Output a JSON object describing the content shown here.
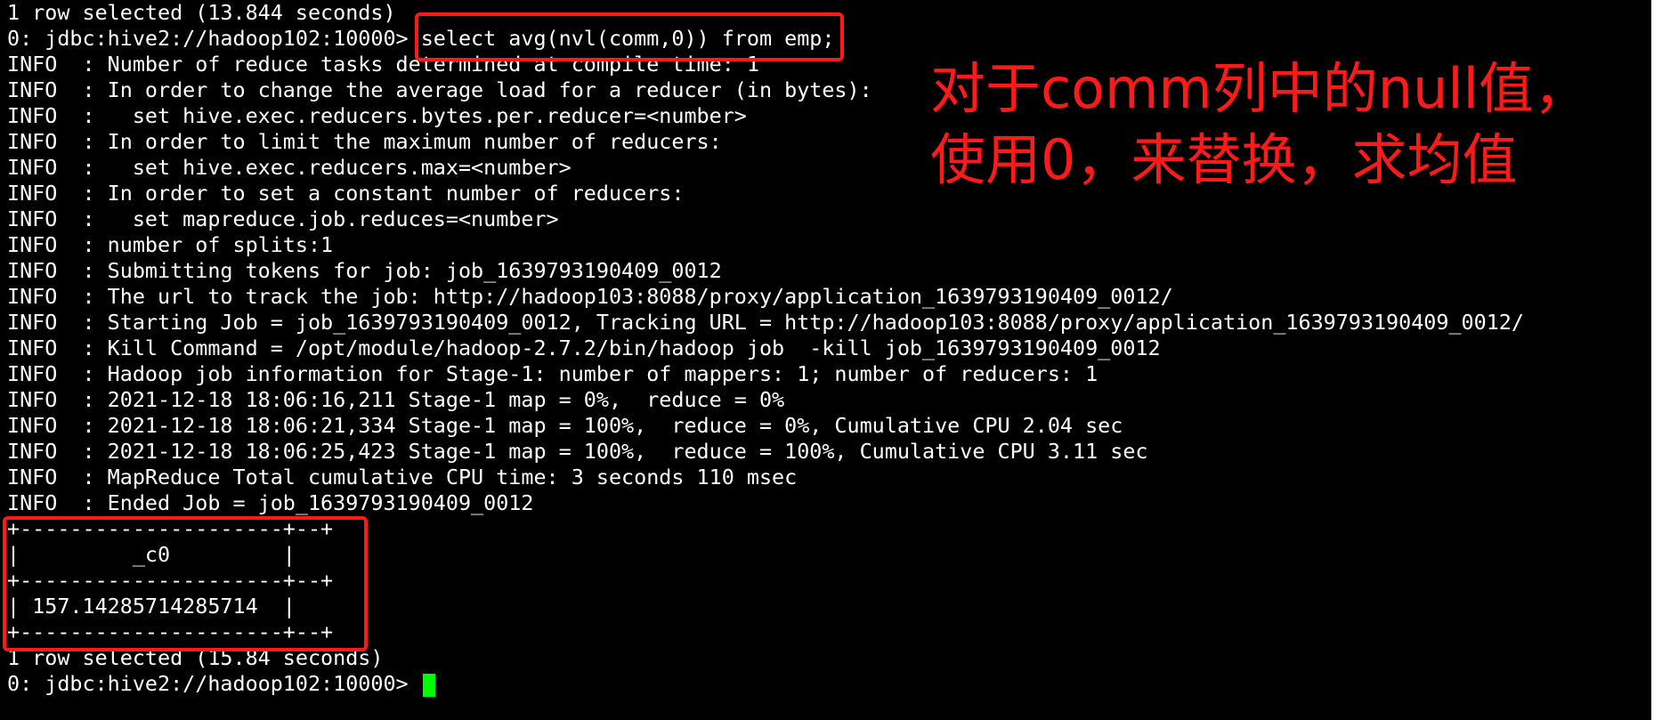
{
  "terminal": {
    "lines": [
      "1 row selected (13.844 seconds)",
      "0: jdbc:hive2://hadoop102:10000> select avg(nvl(comm,0)) from emp;",
      "INFO  : Number of reduce tasks determined at compile time: 1",
      "INFO  : In order to change the average load for a reducer (in bytes):",
      "INFO  :   set hive.exec.reducers.bytes.per.reducer=<number>",
      "INFO  : In order to limit the maximum number of reducers:",
      "INFO  :   set hive.exec.reducers.max=<number>",
      "INFO  : In order to set a constant number of reducers:",
      "INFO  :   set mapreduce.job.reduces=<number>",
      "INFO  : number of splits:1",
      "INFO  : Submitting tokens for job: job_1639793190409_0012",
      "INFO  : The url to track the job: http://hadoop103:8088/proxy/application_1639793190409_0012/",
      "INFO  : Starting Job = job_1639793190409_0012, Tracking URL = http://hadoop103:8088/proxy/application_1639793190409_0012/",
      "INFO  : Kill Command = /opt/module/hadoop-2.7.2/bin/hadoop job  -kill job_1639793190409_0012",
      "INFO  : Hadoop job information for Stage-1: number of mappers: 1; number of reducers: 1",
      "INFO  : 2021-12-18 18:06:16,211 Stage-1 map = 0%,  reduce = 0%",
      "INFO  : 2021-12-18 18:06:21,334 Stage-1 map = 100%,  reduce = 0%, Cumulative CPU 2.04 sec",
      "INFO  : 2021-12-18 18:06:25,423 Stage-1 map = 100%,  reduce = 100%, Cumulative CPU 3.11 sec",
      "INFO  : MapReduce Total cumulative CPU time: 3 seconds 110 msec",
      "INFO  : Ended Job = job_1639793190409_0012",
      "+---------------------+--+",
      "|         _c0         |",
      "+---------------------+--+",
      "| 157.14285714285714  |",
      "+---------------------+--+",
      "1 row selected (15.84 seconds)",
      "0: jdbc:hive2://hadoop102:10000> "
    ]
  },
  "annotation": {
    "line1": "对于comm列中的null值，",
    "line2": "使用0，来替换，求均值"
  },
  "colors": {
    "background": "#000000",
    "text": "#ffffff",
    "highlight": "#ff1a1a",
    "cursor": "#00ff00"
  }
}
